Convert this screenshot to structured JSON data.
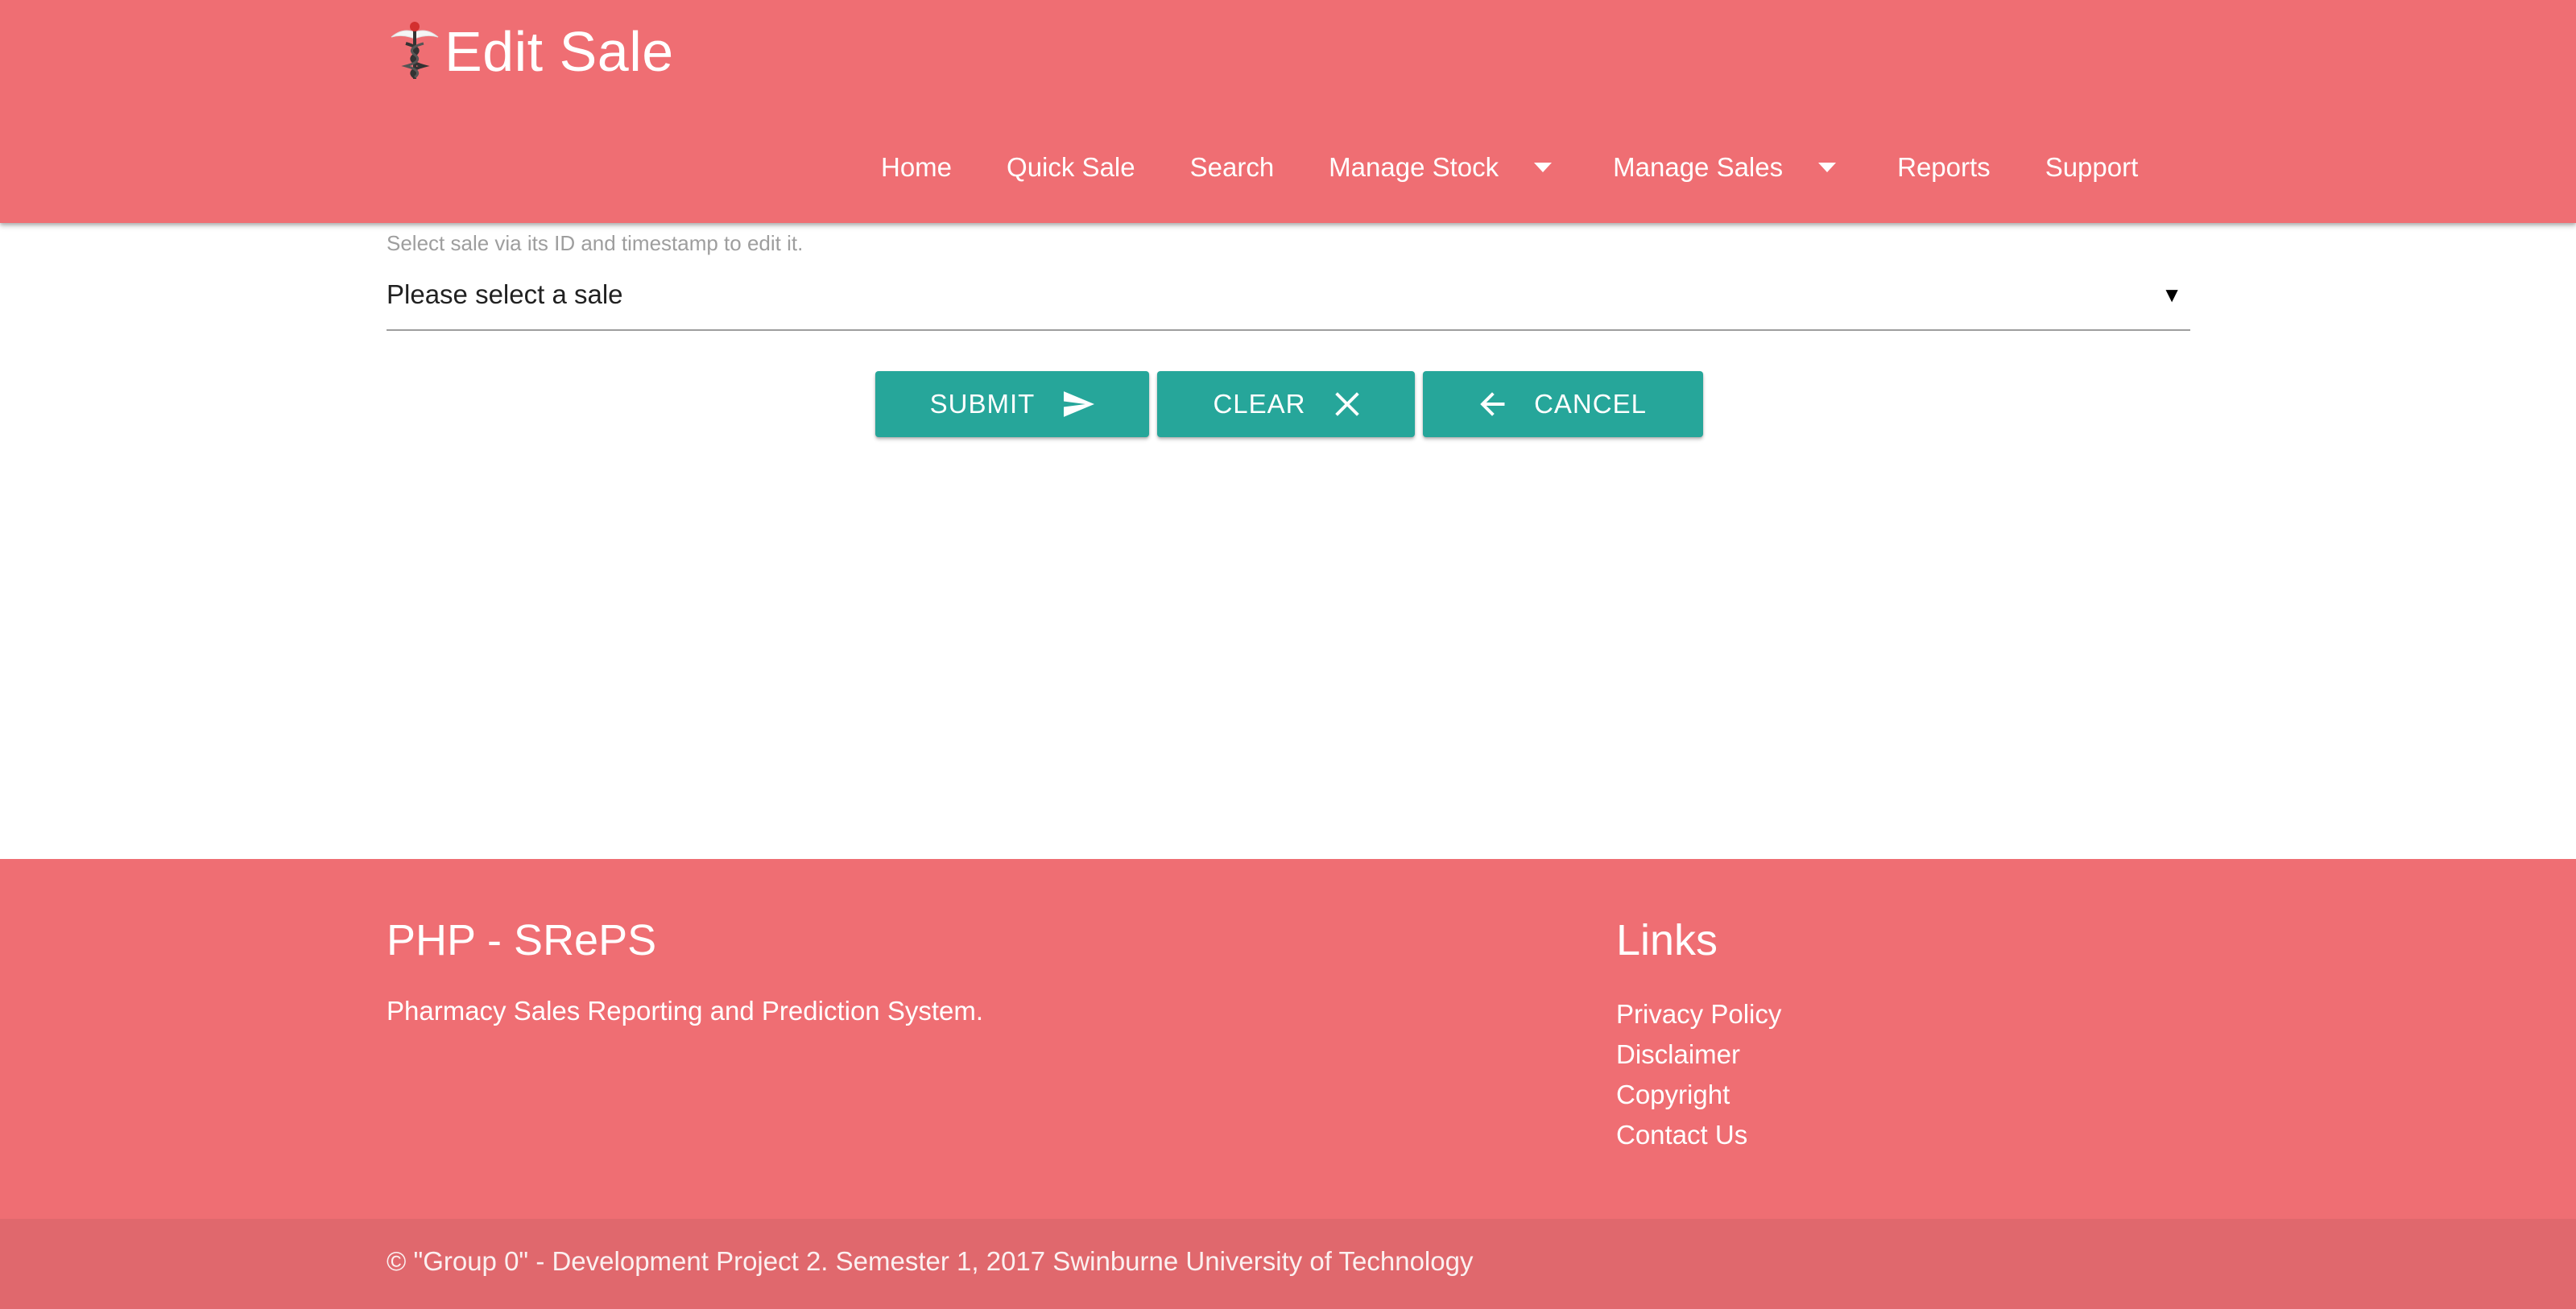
{
  "header": {
    "title": "Edit Sale",
    "logo_icon": "caduceus-icon",
    "nav": [
      {
        "label": "Home",
        "dropdown": false
      },
      {
        "label": "Quick Sale",
        "dropdown": false
      },
      {
        "label": "Search",
        "dropdown": false
      },
      {
        "label": "Manage Stock",
        "dropdown": true
      },
      {
        "label": "Manage Sales",
        "dropdown": true
      },
      {
        "label": "Reports",
        "dropdown": false
      },
      {
        "label": "Support",
        "dropdown": false
      }
    ]
  },
  "form": {
    "helper_text": "Select sale via its ID and timestamp to edit it.",
    "sale_select": {
      "selected": "Please select a sale",
      "arrow": "▼"
    },
    "buttons": {
      "submit_label": "SUBMIT",
      "clear_label": "CLEAR",
      "cancel_label": "CANCEL"
    }
  },
  "footer": {
    "title": "PHP - SRePS",
    "description": "Pharmacy Sales Reporting and Prediction System.",
    "links_title": "Links",
    "links": [
      "Privacy Policy",
      "Disclaimer",
      "Copyright",
      "Contact Us"
    ],
    "copyright": "© \"Group 0\" - Development Project 2. Semester 1, 2017 Swinburne University of Technology"
  },
  "colors": {
    "primary": "#ef6e73",
    "primary_dark": "#e0686d",
    "accent": "#26a69a",
    "text_muted": "#9e9e9e"
  }
}
